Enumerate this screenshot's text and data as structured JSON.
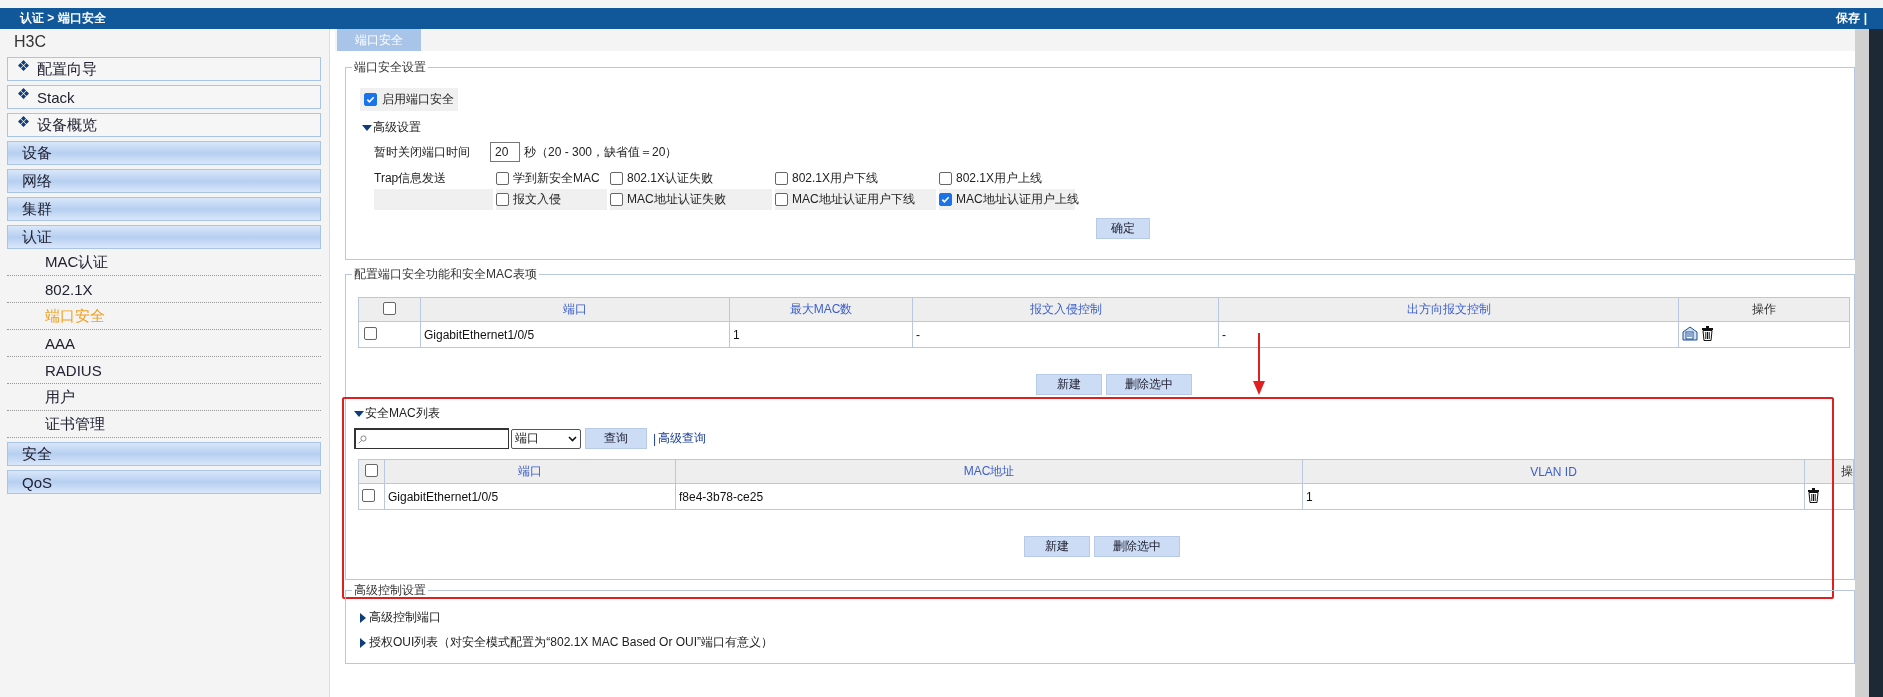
{
  "header": {
    "breadcrumb": "认证 > 端口安全",
    "actions": "保存 |"
  },
  "sidebar": {
    "brand": "H3C",
    "items": [
      {
        "label": "配置向导",
        "kind": "wizard"
      },
      {
        "label": "Stack",
        "kind": "wizard"
      },
      {
        "label": "设备概览",
        "kind": "wizard"
      },
      {
        "label": "设备",
        "kind": "group"
      },
      {
        "label": "网络",
        "kind": "group"
      },
      {
        "label": "集群",
        "kind": "group"
      },
      {
        "label": "认证",
        "kind": "group",
        "children": [
          {
            "label": "MAC认证",
            "selected": false
          },
          {
            "label": "802.1X",
            "selected": false
          },
          {
            "label": "端口安全",
            "selected": true
          },
          {
            "label": "AAA",
            "selected": false
          },
          {
            "label": "RADIUS",
            "selected": false
          },
          {
            "label": "用户",
            "selected": false
          },
          {
            "label": "证书管理",
            "selected": false
          }
        ]
      },
      {
        "label": "安全",
        "kind": "group"
      },
      {
        "label": "QoS",
        "kind": "group"
      }
    ]
  },
  "tabs": [
    {
      "label": "端口安全",
      "selected": true
    }
  ],
  "port_security_settings": {
    "legend": "端口安全设置",
    "enable": {
      "label": "启用端口安全",
      "checked": true
    },
    "advanced": {
      "label": "高级设置",
      "expanded": true
    },
    "close_time": {
      "label": "暂时关闭端口时间",
      "value": "20",
      "unit": "秒（20 - 300，缺省值＝20）"
    },
    "trap": {
      "label": "Trap信息发送",
      "options": [
        {
          "label": "学到新安全MAC",
          "checked": false
        },
        {
          "label": "802.1X认证失败",
          "checked": false
        },
        {
          "label": "802.1X用户下线",
          "checked": false
        },
        {
          "label": "802.1X用户上线",
          "checked": false
        },
        {
          "label": "报文入侵",
          "checked": false
        },
        {
          "label": "MAC地址认证失败",
          "checked": false
        },
        {
          "label": "MAC地址认证用户下线",
          "checked": false
        },
        {
          "label": "MAC地址认证用户上线",
          "checked": true
        }
      ]
    },
    "confirm_button": "确定"
  },
  "port_config": {
    "legend": "配置端口安全功能和安全MAC表项",
    "table": {
      "select_all_checked": false,
      "columns": [
        "端口",
        "最大MAC数",
        "报文入侵控制",
        "出方向报文控制",
        "操作"
      ],
      "rows": [
        {
          "checked": false,
          "cells": [
            "GigabitEthernet1/0/5",
            "1",
            "-",
            "-"
          ]
        }
      ]
    },
    "buttons": [
      "新建",
      "删除选中"
    ],
    "mac_list": {
      "label": "安全MAC列表",
      "expanded": true,
      "filter": "端口",
      "query_button": "查询",
      "separator": "|",
      "advanced_link": "高级查询",
      "table": {
        "select_all_checked": false,
        "columns": [
          "端口",
          "MAC地址",
          "VLAN ID",
          "操"
        ],
        "rows": [
          {
            "checked": false,
            "cells": [
              "GigabitEthernet1/0/5",
              "f8e4-3b78-ce25",
              "1"
            ]
          }
        ]
      },
      "buttons": [
        "新建",
        "删除选中"
      ]
    }
  },
  "advanced_control": {
    "legend": "高级控制设置",
    "items": [
      {
        "label": "高级控制端口",
        "expanded": false
      },
      {
        "label": "授权OUI列表（对安全模式配置为“802.1X MAC Based Or OUI”端口有意义）",
        "expanded": false
      }
    ]
  }
}
